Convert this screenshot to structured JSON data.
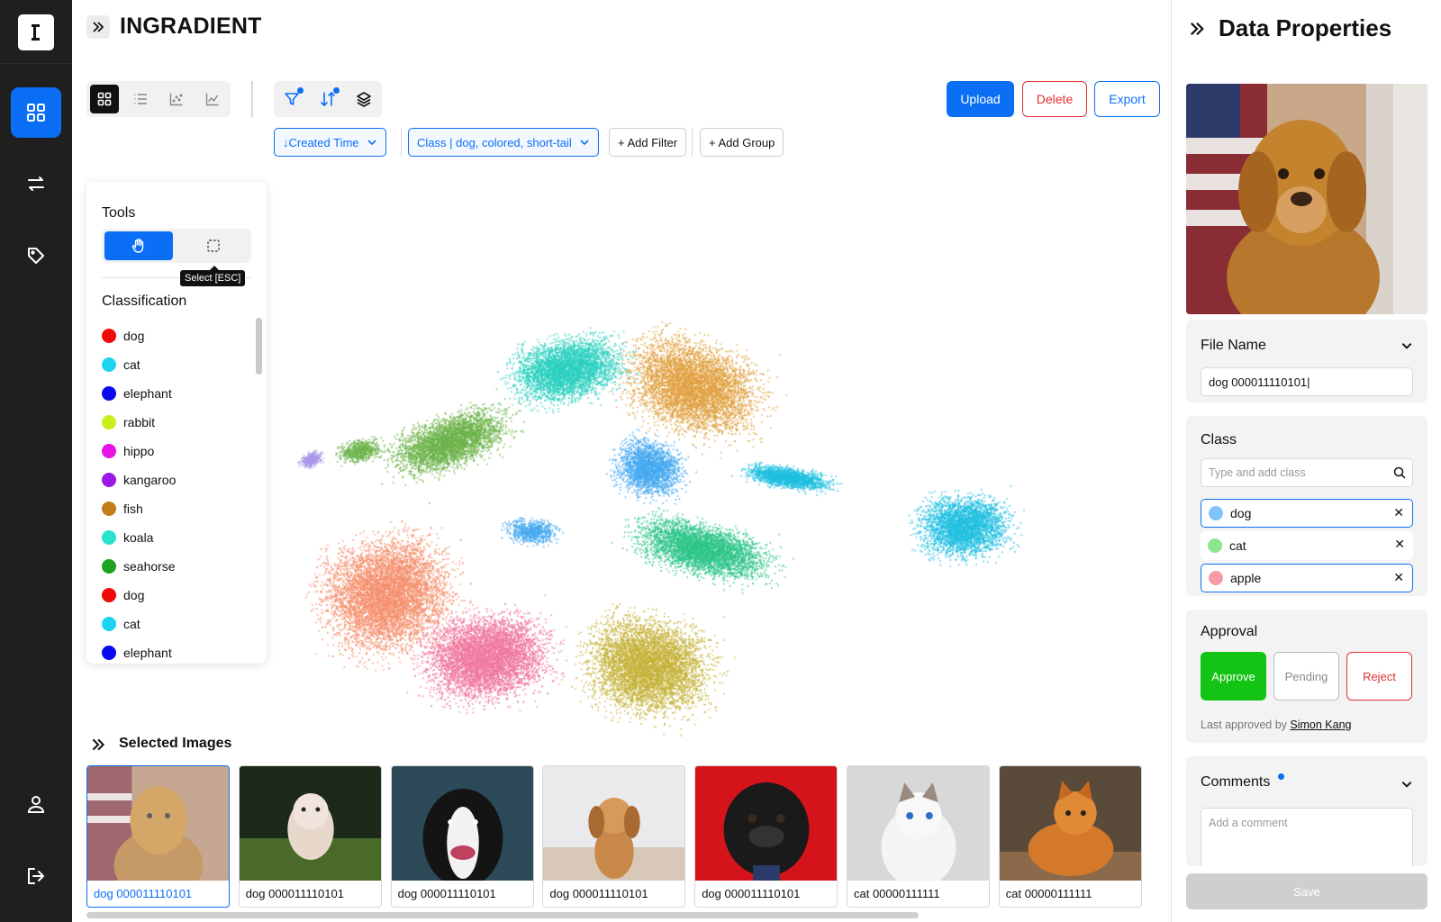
{
  "app": {
    "title": "INGRADIENT"
  },
  "sidebar": {
    "logo": "ingradient-logo",
    "items": [
      {
        "name": "grid-icon",
        "active": true
      },
      {
        "name": "arrows-exchange-icon",
        "active": false
      },
      {
        "name": "tag-icon",
        "active": false
      },
      {
        "name": "user-icon",
        "active": false
      },
      {
        "name": "logout-icon",
        "active": false
      }
    ]
  },
  "view_tabs": [
    "grid-view-icon",
    "list-view-icon",
    "scatter-view-icon",
    "line-chart-icon"
  ],
  "toolbar": {
    "upload_label": "Upload",
    "delete_label": "Delete",
    "export_label": "Export"
  },
  "filters": {
    "sort_label": "↓Created Time",
    "class_filter_label": "Class | dog, colored, short-tail",
    "add_filter_label": "+ Add Filter",
    "add_group_label": "+ Add Group"
  },
  "tools_panel": {
    "title": "Tools",
    "tooltip": "Select [ESC]",
    "classification_title": "Classification",
    "classes": [
      {
        "label": "dog",
        "color": "#f00a0a"
      },
      {
        "label": "cat",
        "color": "#1ed3f0"
      },
      {
        "label": "elephant",
        "color": "#0a0af0"
      },
      {
        "label": "rabbit",
        "color": "#c8ef1e"
      },
      {
        "label": "hippo",
        "color": "#e612e6"
      },
      {
        "label": "kangaroo",
        "color": "#9b19e6"
      },
      {
        "label": "fish",
        "color": "#c07f19"
      },
      {
        "label": "koala",
        "color": "#25e3cd"
      },
      {
        "label": "seahorse",
        "color": "#21a121"
      },
      {
        "label": "dog",
        "color": "#f00a0a"
      },
      {
        "label": "cat",
        "color": "#1ed3f0"
      },
      {
        "label": "elephant",
        "color": "#0a0af0"
      }
    ]
  },
  "scatter": {
    "colors": [
      "#f5906e",
      "#f07aa0",
      "#c5b33a",
      "#2ec58a",
      "#e0a040",
      "#2ad0c0",
      "#6cb34a",
      "#44a8f0",
      "#20c0e0",
      "#a898e8"
    ]
  },
  "selected_images": {
    "title": "Selected Images",
    "items": [
      {
        "caption": "dog 000011110101",
        "selected": true
      },
      {
        "caption": "dog 000011110101",
        "selected": false
      },
      {
        "caption": "dog 000011110101",
        "selected": false
      },
      {
        "caption": "dog 000011110101",
        "selected": false
      },
      {
        "caption": "dog 000011110101",
        "selected": false
      },
      {
        "caption": "cat 00000111111",
        "selected": false
      },
      {
        "caption": "cat 00000111111",
        "selected": false
      }
    ]
  },
  "properties": {
    "title": "Data Properties",
    "file_name_title": "File Name",
    "file_name_value": "dog 000011110101|",
    "class_title": "Class",
    "class_placeholder": "Type and add class",
    "class_tags": [
      {
        "label": "dog",
        "color": "#7ec4f8",
        "outlined": true
      },
      {
        "label": "cat",
        "color": "#8de68d",
        "outlined": false
      },
      {
        "label": "apple",
        "color": "#f79aa8",
        "outlined": true
      }
    ],
    "approval_title": "Approval",
    "approve_label": "Approve",
    "pending_label": "Pending",
    "reject_label": "Reject",
    "last_approved_prefix": "Last approved by",
    "last_approved_by": "Simon Kang",
    "comments_title": "Comments",
    "comments_placeholder": "Add a comment",
    "save_label": "Save"
  }
}
